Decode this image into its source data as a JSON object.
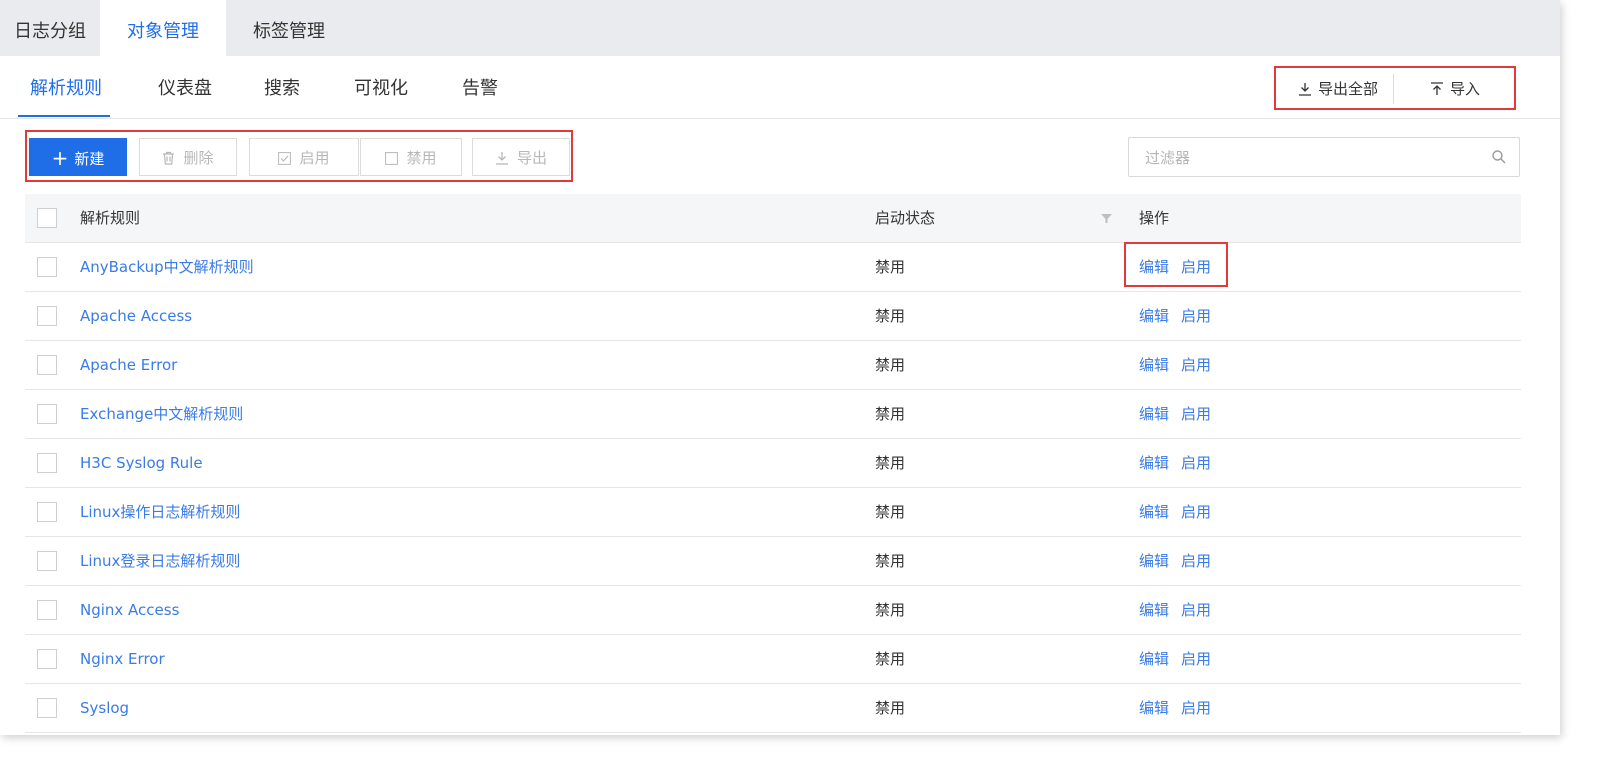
{
  "top_tabs": [
    {
      "label": "日志分组",
      "active": false
    },
    {
      "label": "对象管理",
      "active": true
    },
    {
      "label": "标签管理",
      "active": false
    }
  ],
  "sub_tabs": [
    {
      "label": "解析规则",
      "active": true
    },
    {
      "label": "仪表盘",
      "active": false
    },
    {
      "label": "搜索",
      "active": false
    },
    {
      "label": "可视化",
      "active": false
    },
    {
      "label": "告警",
      "active": false
    }
  ],
  "top_actions": {
    "export_all": "导出全部",
    "import": "导入"
  },
  "toolbar": {
    "new": "新建",
    "delete": "删除",
    "enable": "启用",
    "disable": "禁用",
    "export": "导出"
  },
  "filter": {
    "placeholder": "过滤器"
  },
  "table": {
    "headers": {
      "name": "解析规则",
      "status": "启动状态",
      "ops": "操作"
    },
    "rows": [
      {
        "name": "AnyBackup中文解析规则",
        "status": "禁用",
        "edit": "编辑",
        "enable": "启用"
      },
      {
        "name": "Apache Access",
        "status": "禁用",
        "edit": "编辑",
        "enable": "启用"
      },
      {
        "name": "Apache Error",
        "status": "禁用",
        "edit": "编辑",
        "enable": "启用"
      },
      {
        "name": "Exchange中文解析规则",
        "status": "禁用",
        "edit": "编辑",
        "enable": "启用"
      },
      {
        "name": "H3C Syslog Rule",
        "status": "禁用",
        "edit": "编辑",
        "enable": "启用"
      },
      {
        "name": "Linux操作日志解析规则",
        "status": "禁用",
        "edit": "编辑",
        "enable": "启用"
      },
      {
        "name": "Linux登录日志解析规则",
        "status": "禁用",
        "edit": "编辑",
        "enable": "启用"
      },
      {
        "name": "Nginx Access",
        "status": "禁用",
        "edit": "编辑",
        "enable": "启用"
      },
      {
        "name": "Nginx Error",
        "status": "禁用",
        "edit": "编辑",
        "enable": "启用"
      },
      {
        "name": "Syslog",
        "status": "禁用",
        "edit": "编辑",
        "enable": "启用"
      }
    ]
  },
  "colors": {
    "accent": "#1f6ee8",
    "link": "#3a7be6",
    "highlight": "#e03a3a"
  }
}
